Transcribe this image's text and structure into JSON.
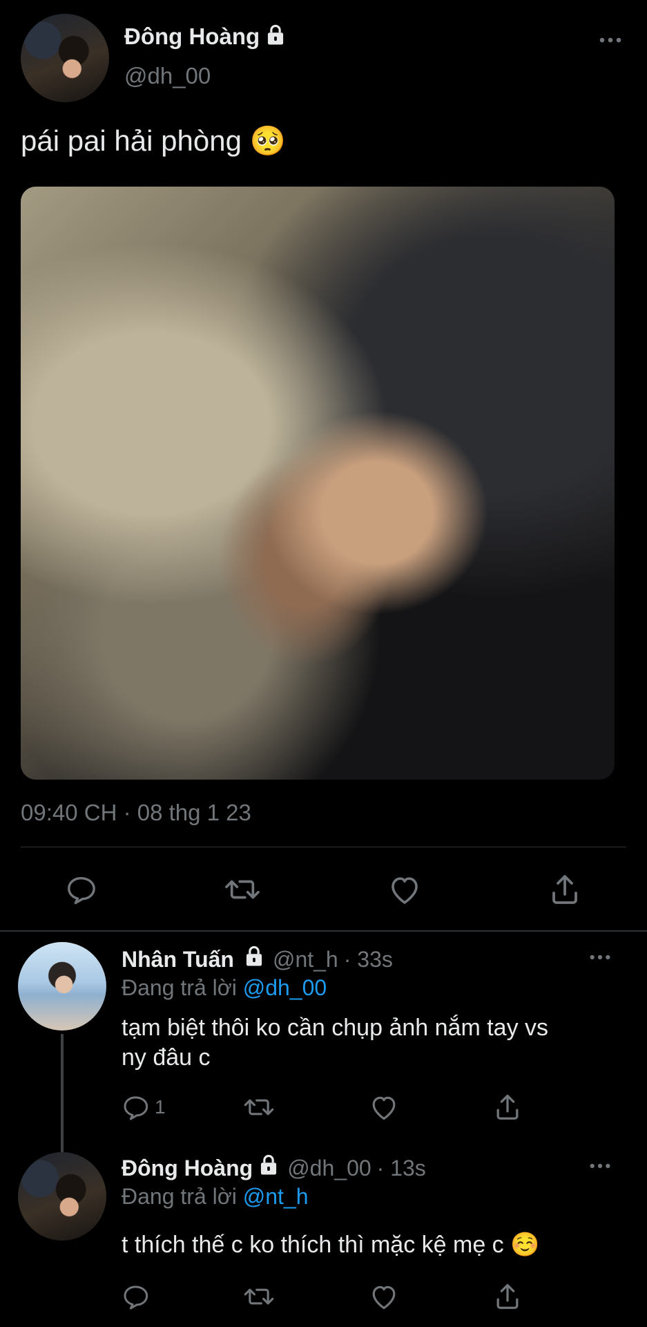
{
  "tweet": {
    "author_name": "Đông Hoàng",
    "handle": "@dh_00",
    "text": "pái pai hải phòng 🥺",
    "timestamp": "09:40 CH · 08 thg 1 23"
  },
  "replies": [
    {
      "author_name": "Nhân Tuấn",
      "handle": "@nt_h",
      "time": "· 33s",
      "replying_prefix": "Đang trả lời",
      "replying_to": "@dh_00",
      "text_line1": "tạm biệt thôi ko cần chụp ảnh nắm tay vs",
      "text_line2": "ny đâu c",
      "reply_count": "1"
    },
    {
      "author_name": "Đông Hoàng",
      "handle": "@dh_00",
      "time": "· 13s",
      "replying_prefix": "Đang trả lời",
      "replying_to": "@nt_h",
      "text": "t thích thế c ko thích thì mặc kệ mẹ c ☺️"
    }
  ],
  "icons": {
    "more": "more-icon",
    "reply": "reply-icon",
    "retweet": "retweet-icon",
    "like": "like-icon",
    "share": "share-icon",
    "lock": "lock-icon"
  },
  "colors": {
    "background": "#000000",
    "text": "#e7e9ea",
    "muted": "#71767b",
    "accent": "#1d9bf0"
  }
}
